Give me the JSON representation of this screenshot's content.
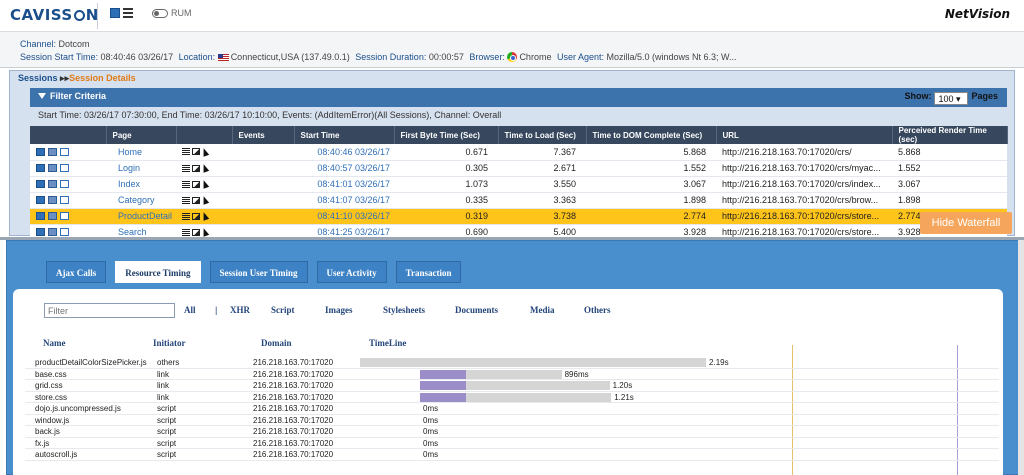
{
  "header": {
    "logo": "CAVISSON",
    "rum_label": "RUM",
    "brand": "NetVision"
  },
  "session_info": {
    "channel_label": "Channel:",
    "channel": "Dotcom",
    "start_label": "Session Start Time:",
    "start": "08:40:46 03/26/17",
    "location_label": "Location:",
    "location": "Connecticut,USA (137.49.0.1)",
    "duration_label": "Session Duration:",
    "duration": "00:00:57",
    "browser_label": "Browser:",
    "browser": "Chrome",
    "agent_label": "User Agent:",
    "agent": "Mozilla/5.0 (windows Nt 6.3; W..."
  },
  "breadcrumb": {
    "sessions": "Sessions",
    "sep": "▸▸",
    "details": "Session Details"
  },
  "filter": {
    "title": "Filter Criteria",
    "show_label": "Show:",
    "show_value": "100",
    "pages_label": "Pages",
    "criteria": "Start Time: 03/26/17 07:30:00, End Time: 03/26/17 10:10:00, Events: (AddItemError)(All Sessions), Channel: Overall"
  },
  "sessions_table": {
    "columns": [
      "",
      "Page",
      "",
      "Events",
      "Start Time",
      "First Byte Time (Sec)",
      "Time to Load (Sec)",
      "Time to DOM Complete (Sec)",
      "URL",
      "Perceived Render Time (sec)"
    ],
    "rows": [
      {
        "page": "Home",
        "start": "08:40:46 03/26/17",
        "first_byte": "0.671",
        "load": "7.367",
        "dom": "5.868",
        "url": "http://216.218.163.70:17020/crs/",
        "render": "5.868"
      },
      {
        "page": "Login",
        "start": "08:40:57 03/26/17",
        "first_byte": "0.305",
        "load": "2.671",
        "dom": "1.552",
        "url": "http://216.218.163.70:17020/crs/myac...",
        "render": "1.552"
      },
      {
        "page": "Index",
        "start": "08:41:01 03/26/17",
        "first_byte": "1.073",
        "load": "3.550",
        "dom": "3.067",
        "url": "http://216.218.163.70:17020/crs/index...",
        "render": "3.067"
      },
      {
        "page": "Category",
        "start": "08:41:07 03/26/17",
        "first_byte": "0.335",
        "load": "3.363",
        "dom": "1.898",
        "url": "http://216.218.163.70:17020/crs/brow...",
        "render": "1.898"
      },
      {
        "page": "ProductDetail",
        "start": "08:41:10 03/26/17",
        "first_byte": "0.319",
        "load": "3.738",
        "dom": "2.774",
        "url": "http://216.218.163.70:17020/crs/store...",
        "render": "2.774",
        "selected": true
      },
      {
        "page": "Search",
        "start": "08:41:25 03/26/17",
        "first_byte": "0.690",
        "load": "5.400",
        "dom": "3.928",
        "url": "http://216.218.163.70:17020/crs/store...",
        "render": "3.928"
      }
    ]
  },
  "hide_waterfall": "Hide Waterfall",
  "tabs": [
    {
      "label": "Ajax Calls",
      "active": false
    },
    {
      "label": "Resource Timing",
      "active": true
    },
    {
      "label": "Session User Timing",
      "active": false
    },
    {
      "label": "User Activity",
      "active": false
    },
    {
      "label": "Transaction",
      "active": false
    }
  ],
  "resource": {
    "filter_placeholder": "Filter",
    "types": [
      "All",
      "XHR",
      "Script",
      "Images",
      "Stylesheets",
      "Documents",
      "Media",
      "Others"
    ],
    "pipe": "|",
    "columns": [
      "Name",
      "Initiator",
      "Domain",
      "TimeLine"
    ],
    "rows": [
      {
        "name": "productDetailColorSizePicker.js",
        "initiator": "others",
        "domain": "216.218.163.70:17020",
        "label": "2.19s",
        "wait": 0,
        "total": 2.19
      },
      {
        "name": "base.css",
        "initiator": "link",
        "domain": "216.218.163.70:17020",
        "label": "896ms",
        "start": 0.38,
        "wait": 0.29,
        "total": 0.896
      },
      {
        "name": "grid.css",
        "initiator": "link",
        "domain": "216.218.163.70:17020",
        "label": "1.20s",
        "start": 0.38,
        "wait": 0.29,
        "total": 1.2
      },
      {
        "name": "store.css",
        "initiator": "link",
        "domain": "216.218.163.70:17020",
        "label": "1.21s",
        "start": 0.38,
        "wait": 0.29,
        "total": 1.21
      },
      {
        "name": "dojo.js.uncompressed.js",
        "initiator": "script",
        "domain": "216.218.163.70:17020",
        "label": "0ms",
        "start": 0.38,
        "total": 0
      },
      {
        "name": "window.js",
        "initiator": "script",
        "domain": "216.218.163.70:17020",
        "label": "0ms",
        "start": 0.38,
        "total": 0
      },
      {
        "name": "back.js",
        "initiator": "script",
        "domain": "216.218.163.70:17020",
        "label": "0ms",
        "start": 0.38,
        "total": 0
      },
      {
        "name": "fx.js",
        "initiator": "script",
        "domain": "216.218.163.70:17020",
        "label": "0ms",
        "start": 0.38,
        "total": 0
      },
      {
        "name": "autoscroll.js",
        "initiator": "script",
        "domain": "216.218.163.70:17020",
        "label": "0ms",
        "start": 0.38,
        "total": 0
      }
    ]
  },
  "colors": {
    "selected_row": "#ffc419",
    "header_bg": "#36475e",
    "tab_panel": "#4a8fcd",
    "bar_wait": "#9b8ec8",
    "bar_total": "#d5d5d5"
  }
}
